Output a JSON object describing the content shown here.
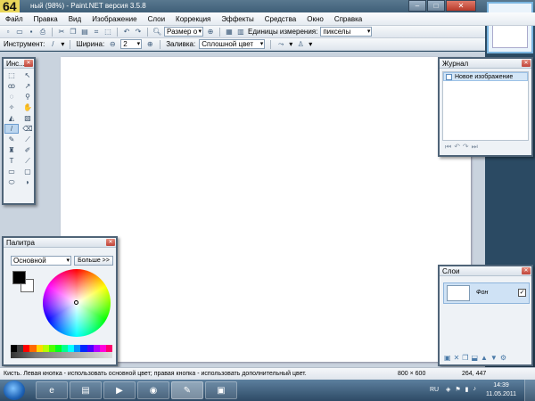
{
  "window": {
    "badge": "64",
    "title": "ный (98%) - Paint.NET версия 3.5.8"
  },
  "menu": [
    "Файл",
    "Правка",
    "Вид",
    "Изображение",
    "Слои",
    "Коррекция",
    "Эффекты",
    "Средства",
    "Окно",
    "Справка"
  ],
  "toolbar1": {
    "zoom_label": "Размер о",
    "units_label": "Единицы измерения:",
    "units_value": "пикселы"
  },
  "toolbar2": {
    "tool_label": "Инструмент:",
    "width_label": "Ширина:",
    "width_value": "2",
    "fill_label": "Заливка:",
    "fill_value": "Сплошной цвет"
  },
  "tools_panel": {
    "title": "Инс..."
  },
  "history_panel": {
    "title": "Журнал",
    "items": [
      "Новое изображение"
    ]
  },
  "palette_panel": {
    "title": "Палитра",
    "mode": "Основной",
    "more_button": "Больше >>",
    "primary_color": "#000000",
    "secondary_color": "#ffffff"
  },
  "layers_panel": {
    "title": "Слои",
    "layers": [
      {
        "name": "Фон",
        "visible": true
      }
    ]
  },
  "status": {
    "message": "Кисть. Левая кнопка - использовать основной цвет; правая кнопка - использовать дополнительный цвет.",
    "image_size": "800 × 600",
    "cursor": "264, 447"
  },
  "tray": {
    "lang": "RU",
    "time": "14:39",
    "date": "11.05.2011"
  }
}
